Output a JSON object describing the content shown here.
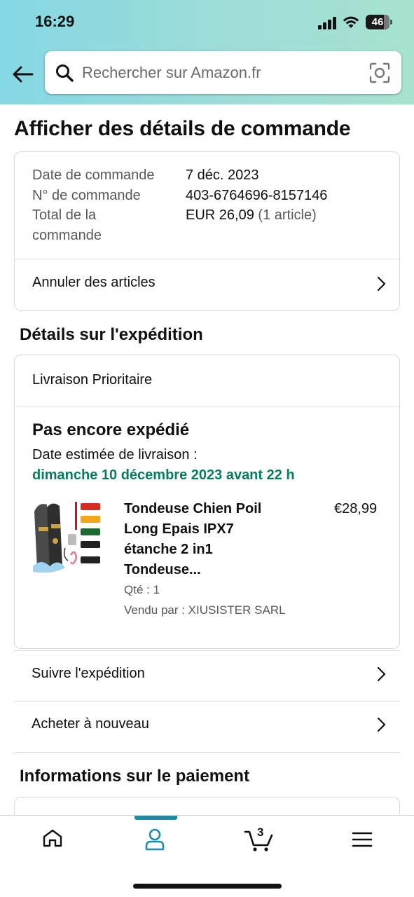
{
  "status_bar": {
    "time": "16:29",
    "battery": "46"
  },
  "search": {
    "placeholder": "Rechercher sur Amazon.fr"
  },
  "page_title": "Afficher des détails de commande",
  "order_summary": {
    "date_label": "Date de commande",
    "date_value": "7 déc. 2023",
    "number_label": "N° de commande",
    "number_value": "403-6764696-8157146",
    "total_label_line1": "Total de la",
    "total_label_line2": "commande",
    "total_value": "EUR 26,09",
    "total_items": "(1 article)",
    "cancel_label": "Annuler des articles"
  },
  "shipping": {
    "section_title": "Détails sur l'expédition",
    "delivery_type": "Livraison Prioritaire",
    "status": "Pas encore expédié",
    "estimate_label": "Date estimée de livraison :",
    "estimate_date": "dimanche 10 décembre 2023 avant 22 h",
    "status_color": "#067d62",
    "product": {
      "title_lines": [
        "Tondeuse Chien Poil",
        "Long Epais IPX7",
        "étanche 2 in1",
        "Tondeuse..."
      ],
      "price": "€28,99",
      "quantity": "Qté : 1",
      "seller": "Vendu par : XIUSISTER SARL"
    }
  },
  "actions": {
    "track": "Suivre l'expédition",
    "buy_again": "Acheter à nouveau"
  },
  "payment": {
    "section_title": "Informations sur le paiement"
  },
  "tab_bar": {
    "tabs": [
      "home-icon",
      "account-icon",
      "cart-icon",
      "menu-icon"
    ],
    "active_tab": "account-icon",
    "cart_count": "3",
    "accent": "#1f8ca3"
  }
}
